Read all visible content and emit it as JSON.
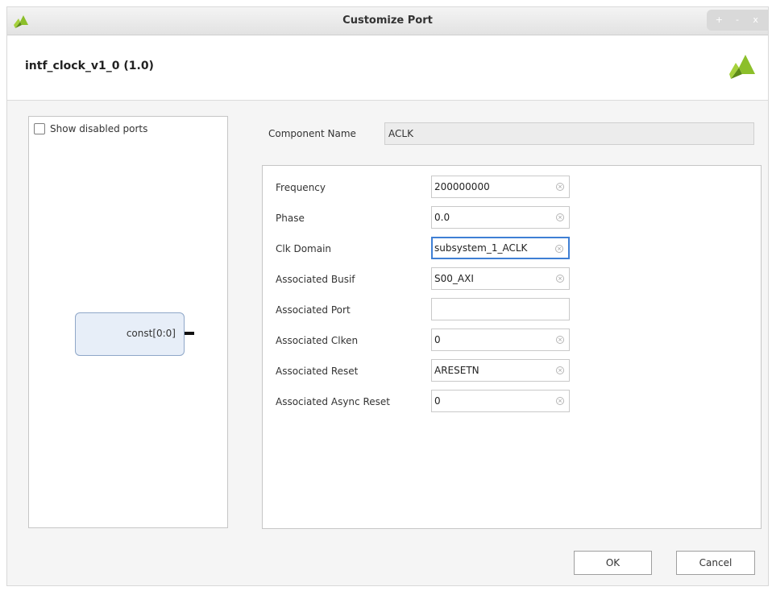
{
  "window": {
    "title": "Customize Port",
    "controls": [
      "+",
      "-",
      "x"
    ]
  },
  "header": {
    "title": "intf_clock_v1_0 (1.0)"
  },
  "left_panel": {
    "show_disabled_label": "Show disabled ports",
    "show_disabled_checked": false,
    "port_label": "const[0:0]"
  },
  "component": {
    "label": "Component Name",
    "value": "ACLK"
  },
  "fields": [
    {
      "label": "Frequency",
      "value": "200000000",
      "clearable": true
    },
    {
      "label": "Phase",
      "value": "0.0",
      "clearable": true
    },
    {
      "label": "Clk Domain",
      "value": "subsystem_1_ACLK",
      "clearable": true,
      "focused": true
    },
    {
      "label": "Associated Busif",
      "value": "S00_AXI",
      "clearable": true
    },
    {
      "label": "Associated Port",
      "value": "",
      "clearable": false
    },
    {
      "label": "Associated Clken",
      "value": "0",
      "clearable": true
    },
    {
      "label": "Associated Reset",
      "value": "ARESETN",
      "clearable": true
    },
    {
      "label": "Associated Async Reset",
      "value": "0",
      "clearable": true
    }
  ],
  "buttons": {
    "ok": "OK",
    "cancel": "Cancel"
  },
  "colors": {
    "logo_green": "#8cbf2a",
    "logo_dark": "#5c8a17",
    "focus_blue": "#3f7fd4"
  },
  "icons": {
    "app_logo": "xilinx-logo-icon",
    "clear": "clear-field-icon"
  }
}
